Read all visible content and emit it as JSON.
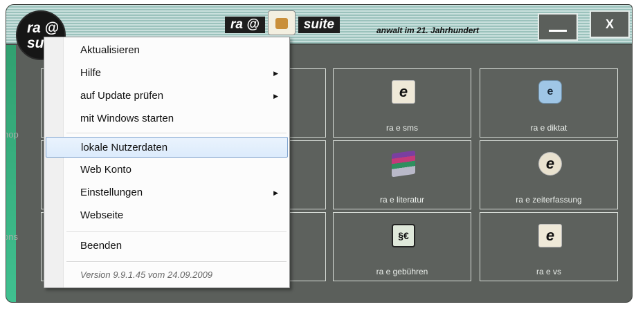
{
  "window": {
    "logo_line1": "ra",
    "logo_at": "@",
    "logo_line2": "su",
    "title_left": "ra @",
    "title_right": "suite",
    "tagline": "anwalt im 21. Jahrhundert",
    "minimize_label": "",
    "close_label": "X"
  },
  "side_texts": [
    "hop",
    "ons"
  ],
  "tiles": [
    {
      "label": "ra e sms",
      "icon": "e-note-icon"
    },
    {
      "label": "ra e diktat",
      "icon": "dictaphone-icon"
    },
    {
      "label": "ra e literatur",
      "icon": "books-icon"
    },
    {
      "label": "ra e zeiterfassung",
      "icon": "clock-e-icon"
    },
    {
      "label": "ra e gebühren",
      "icon": "law-book-icon"
    },
    {
      "label": "ra e vs",
      "icon": "e-card-icon"
    }
  ],
  "menu": {
    "items": [
      {
        "label": "Aktualisieren"
      },
      {
        "label": "Hilfe",
        "submenu": true
      },
      {
        "label": "auf Update prüfen",
        "submenu": true
      },
      {
        "label": "mit Windows starten"
      },
      {
        "label": "lokale Nutzerdaten",
        "selected": true
      },
      {
        "label": "Web Konto"
      },
      {
        "label": "Einstellungen",
        "submenu": true
      },
      {
        "label": "Webseite"
      },
      {
        "label": "Beenden"
      }
    ],
    "version": "Version 9.9.1.45 vom 24.09.2009"
  },
  "colors": {
    "window_bg": "#5b5f5b",
    "titlebar_stripe": "#c9e0dd",
    "menu_selected": "#dcebfc",
    "accent": "#2f9b6b"
  }
}
